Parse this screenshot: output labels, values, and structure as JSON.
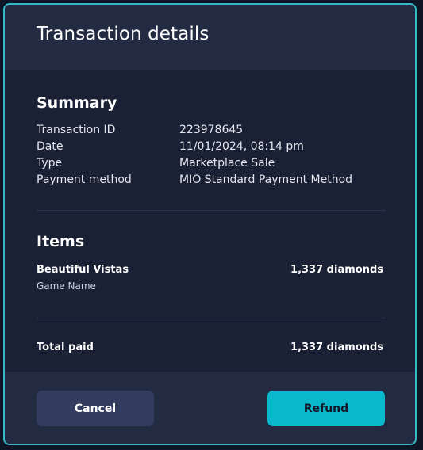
{
  "header": {
    "title": "Transaction details"
  },
  "summary": {
    "title": "Summary",
    "rows": [
      {
        "label": "Transaction ID",
        "value": "223978645"
      },
      {
        "label": "Date",
        "value": "11/01/2024, 08:14 pm"
      },
      {
        "label": "Type",
        "value": "Marketplace Sale"
      },
      {
        "label": "Payment method",
        "value": "MIO Standard Payment Method"
      }
    ]
  },
  "items": {
    "title": "Items",
    "list": [
      {
        "name": "Beautiful Vistas",
        "subtitle": "Game Name",
        "price": "1,337 diamonds"
      }
    ]
  },
  "total": {
    "label": "Total paid",
    "value": "1,337 diamonds"
  },
  "footer": {
    "cancel_label": "Cancel",
    "refund_label": "Refund"
  },
  "colors": {
    "accent": "#0ab8cc",
    "border": "#35b9c6",
    "header_bg": "#232b43",
    "body_bg": "#1a2134"
  }
}
